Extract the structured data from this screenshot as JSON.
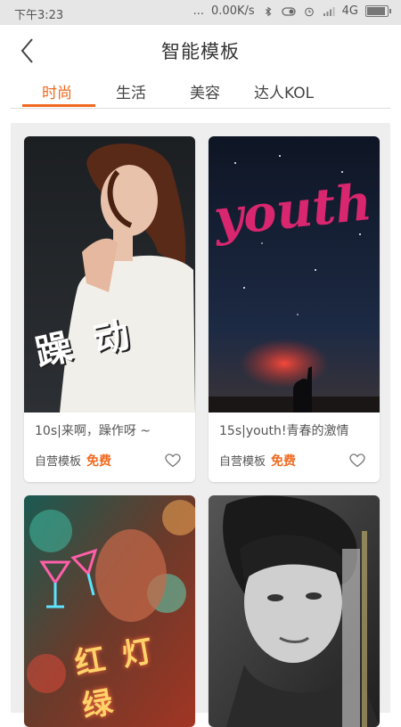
{
  "status_bar": {
    "time": "下午3:23",
    "network_speed": "0.00K/s",
    "network_type": "4G",
    "battery_level": 0.9,
    "icons": [
      "dots-icon",
      "bluetooth-icon",
      "toggle-icon",
      "alarm-icon",
      "signal-icon",
      "battery-icon"
    ],
    "dots": "..."
  },
  "header": {
    "back_icon": "chevron-left-icon",
    "title": "智能模板"
  },
  "tabs": [
    {
      "label": "时尚",
      "active": true
    },
    {
      "label": "生活",
      "active": false
    },
    {
      "label": "美容",
      "active": false
    },
    {
      "label": "达人KOL",
      "active": false
    }
  ],
  "colors": {
    "accent": "#f0691e",
    "grid_background": "#eeeeee",
    "status_bar": "#e6e6e6"
  },
  "templates": [
    {
      "title": "10s|来啊，躁作呀 ~",
      "source": "自营模板",
      "price": "免费",
      "icon": "heart-icon",
      "overlay_text": "躁 动"
    },
    {
      "title": "15s|youth!青春的激情",
      "source": "自营模板",
      "price": "免费",
      "icon": "heart-icon",
      "overlay_text": "youth"
    },
    {
      "title": "",
      "source": "",
      "price": "",
      "icon": "",
      "overlay_text": "红 灯 绿"
    },
    {
      "title": "",
      "source": "",
      "price": "",
      "icon": "",
      "overlay_text": ""
    }
  ]
}
